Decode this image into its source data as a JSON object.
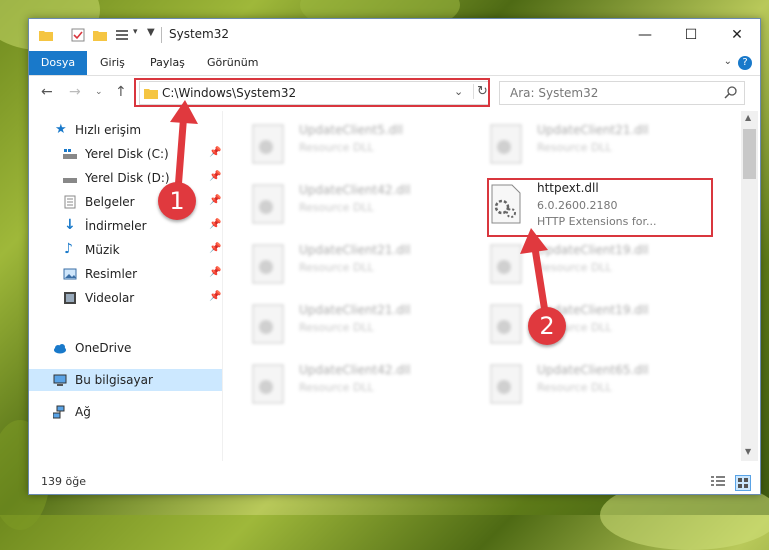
{
  "window": {
    "title": "System32",
    "controls": {
      "minimize": "—",
      "maximize": "☐",
      "close": "✕"
    }
  },
  "ribbon": {
    "tabs": [
      "Dosya",
      "Giriş",
      "Paylaş",
      "Görünüm"
    ],
    "help": "?"
  },
  "address": {
    "path": "C:\\Windows\\System32",
    "search_placeholder": "Ara: System32"
  },
  "sidebar": {
    "items": [
      {
        "label": "Hızlı erişim",
        "icon": "star-icon"
      },
      {
        "label": "Yerel Disk (C:)",
        "icon": "drive-icon",
        "pinned": true
      },
      {
        "label": "Yerel Disk (D:)",
        "icon": "drive-icon",
        "pinned": true
      },
      {
        "label": "Belgeler",
        "icon": "documents-icon",
        "pinned": true
      },
      {
        "label": "İndirmeler",
        "icon": "download-icon",
        "pinned": true
      },
      {
        "label": "Müzik",
        "icon": "music-icon",
        "pinned": true
      },
      {
        "label": "Resimler",
        "icon": "pictures-icon",
        "pinned": true
      },
      {
        "label": "Videolar",
        "icon": "videos-icon",
        "pinned": true
      },
      {
        "label": "OneDrive",
        "icon": "cloud-icon"
      },
      {
        "label": "Bu bilgisayar",
        "icon": "computer-icon",
        "selected": true
      },
      {
        "label": "Ağ",
        "icon": "network-icon"
      }
    ]
  },
  "files": {
    "blurred": [
      {
        "name": "UpdateClient5.dll",
        "desc": "Resource DLL"
      },
      {
        "name": "UpdateClient21.dll",
        "desc": "Resource DLL"
      },
      {
        "name": "UpdateClient42.dll",
        "desc": "Resource DLL"
      },
      {
        "name": "UpdateClient21.dll",
        "desc": "Resource DLL"
      },
      {
        "name": "UpdateClient19.dll",
        "desc": "Resource DLL"
      },
      {
        "name": "UpdateClient21.dll",
        "desc": "Resource DLL"
      },
      {
        "name": "UpdateClient19.dll",
        "desc": "Resource DLL"
      },
      {
        "name": "UpdateClient42.dll",
        "desc": "Resource DLL"
      },
      {
        "name": "UpdateClient65.dll",
        "desc": "Resource DLL"
      }
    ],
    "highlighted": {
      "name": "httpext.dll",
      "version": "6.0.2600.2180",
      "desc": "HTTP Extensions for..."
    }
  },
  "status": {
    "count": "139 öğe"
  },
  "annotations": {
    "step1": "1",
    "step2": "2"
  },
  "colors": {
    "accent": "#1979ca",
    "highlight": "#d9363e",
    "selected": "#cce8ff"
  }
}
